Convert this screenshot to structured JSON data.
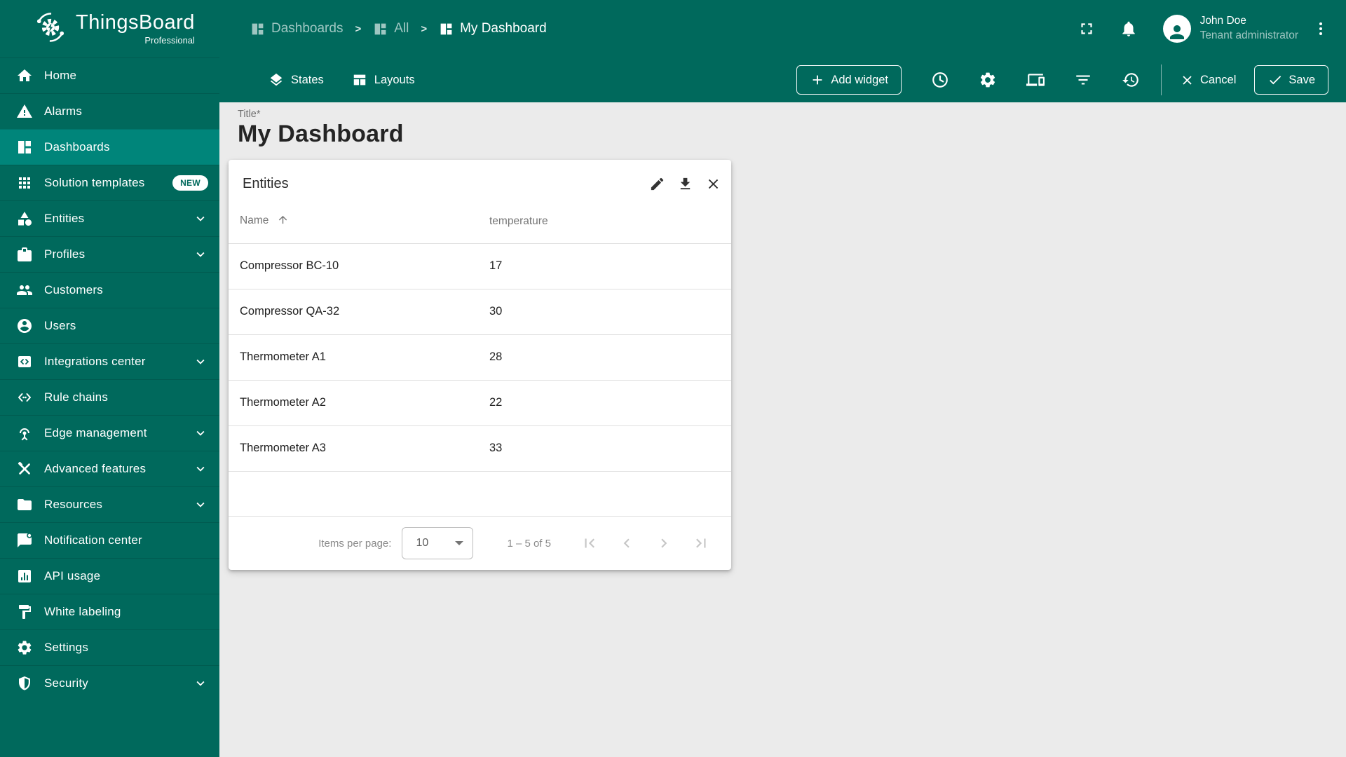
{
  "brand": {
    "name": "ThingsBoard",
    "edition": "Professional"
  },
  "breadcrumb": {
    "separator": ">",
    "items": [
      {
        "label": "Dashboards"
      },
      {
        "label": "All"
      },
      {
        "label": "My Dashboard"
      }
    ]
  },
  "user": {
    "name": "John Doe",
    "role": "Tenant administrator"
  },
  "sidebar": {
    "items": [
      {
        "label": "Home"
      },
      {
        "label": "Alarms"
      },
      {
        "label": "Dashboards",
        "active": true
      },
      {
        "label": "Solution templates",
        "badge": "NEW"
      },
      {
        "label": "Entities",
        "expandable": true
      },
      {
        "label": "Profiles",
        "expandable": true
      },
      {
        "label": "Customers"
      },
      {
        "label": "Users"
      },
      {
        "label": "Integrations center",
        "expandable": true
      },
      {
        "label": "Rule chains"
      },
      {
        "label": "Edge management",
        "expandable": true
      },
      {
        "label": "Advanced features",
        "expandable": true
      },
      {
        "label": "Resources",
        "expandable": true
      },
      {
        "label": "Notification center"
      },
      {
        "label": "API usage"
      },
      {
        "label": "White labeling"
      },
      {
        "label": "Settings"
      },
      {
        "label": "Security",
        "expandable": true
      }
    ]
  },
  "toolbar": {
    "states": "States",
    "layouts": "Layouts",
    "add_widget": "Add widget",
    "cancel": "Cancel",
    "save": "Save"
  },
  "page": {
    "title_label": "Title*",
    "title": "My Dashboard"
  },
  "widget": {
    "title": "Entities",
    "table": {
      "columns": [
        {
          "label": "Name",
          "sorted": "asc"
        },
        {
          "label": "temperature"
        }
      ],
      "rows": [
        [
          "Compressor BC-10",
          "17"
        ],
        [
          "Compressor QA-32",
          "30"
        ],
        [
          "Thermometer A1",
          "28"
        ],
        [
          "Thermometer A2",
          "22"
        ],
        [
          "Thermometer A3",
          "33"
        ]
      ]
    },
    "pagination": {
      "items_per_page_label": "Items per page:",
      "page_size": "10",
      "range": "1 – 5 of 5"
    }
  },
  "colors": {
    "teal": "#00695C",
    "teal_active": "#00857A",
    "content_bg": "#EBEBEB",
    "card_bg": "#FFFFFF",
    "text_dark": "#212121",
    "text_gray": "#757575",
    "disabled_icon": "#C6C6C6",
    "badge_bg": "#FFFFFF",
    "badge_text": "#00695C"
  }
}
